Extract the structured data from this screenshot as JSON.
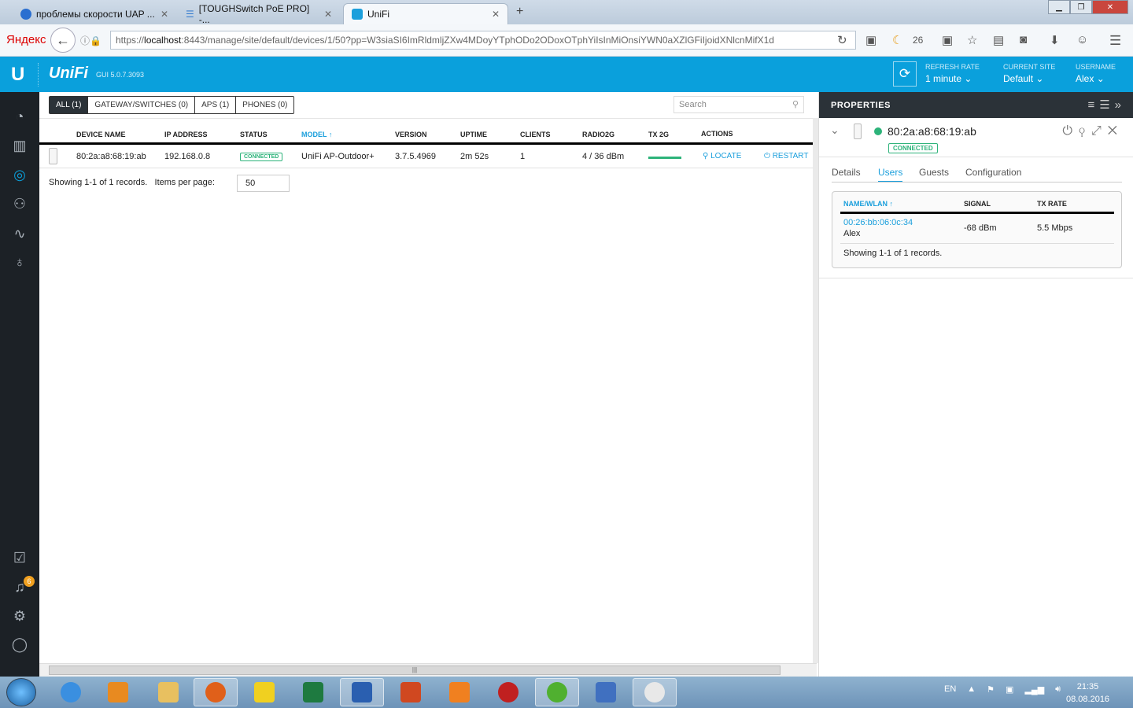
{
  "browser": {
    "tabs": [
      {
        "label": "проблемы скорости UAP ...",
        "icon": "nag-icon"
      },
      {
        "label": "[TOUGHSwitch PoE PRO] -...",
        "icon": "rss-icon"
      },
      {
        "label": "UniFi",
        "icon": "unifi-icon",
        "active": true
      }
    ],
    "brand": "Яндекс",
    "url_prefix": "https://",
    "url_host": "localhost",
    "url_rest": ":8443/manage/site/default/devices/1/50?pp=W3siaSI6ImRldmljZXw4MDoyYTphODo2ODoxOTphYiIsInMiOnsiYWN0aXZlGFiIjoidXNlcnMifX1d",
    "moon_count": "26"
  },
  "header": {
    "logo": "U",
    "brand": "UniFi",
    "version": "GUI 5.0.7.3093",
    "refresh_label": "REFRESH RATE",
    "refresh_value": "1 minute",
    "site_label": "CURRENT SITE",
    "site_value": "Default",
    "user_label": "USERNAME",
    "user_value": "Alex"
  },
  "sidebar": {
    "notification_count": "6"
  },
  "devices": {
    "filters": [
      "ALL (1)",
      "GATEWAY/SWITCHES (0)",
      "APS (1)",
      "PHONES (0)"
    ],
    "search_placeholder": "Search",
    "columns": [
      "DEVICE NAME",
      "IP ADDRESS",
      "STATUS",
      "MODEL ↑",
      "VERSION",
      "UPTIME",
      "CLIENTS",
      "RADIO2G",
      "TX 2G",
      "ACTIONS"
    ],
    "row": {
      "name": "80:2a:a8:68:19:ab",
      "ip": "192.168.0.8",
      "status": "CONNECTED",
      "model": "UniFi AP-Outdoor+",
      "version": "3.7.5.4969",
      "uptime": "2m 52s",
      "clients": "1",
      "radio": "4 / 36 dBm",
      "tx_fraction": 1.0,
      "locate": "LOCATE",
      "restart": "RESTART"
    },
    "showing": "Showing 1-1 of 1 records.",
    "items_label": "Items per page:",
    "items_value": "50"
  },
  "properties": {
    "title": "PROPERTIES",
    "device": "80:2a:a8:68:19:ab",
    "status": "CONNECTED",
    "tabs": [
      "Details",
      "Users",
      "Guests",
      "Configuration"
    ],
    "users": {
      "columns": [
        "NAME/WLAN ↑",
        "SIGNAL",
        "TX RATE"
      ],
      "row": {
        "mac": "00:26:bb:06:0c:34",
        "name": "Alex",
        "signal": "-68 dBm",
        "rate": "5.5 Mbps"
      },
      "showing": "Showing 1-1 of 1 records."
    }
  },
  "taskbar": {
    "lang": "EN",
    "time": "21:35",
    "date": "08.08.2016"
  }
}
